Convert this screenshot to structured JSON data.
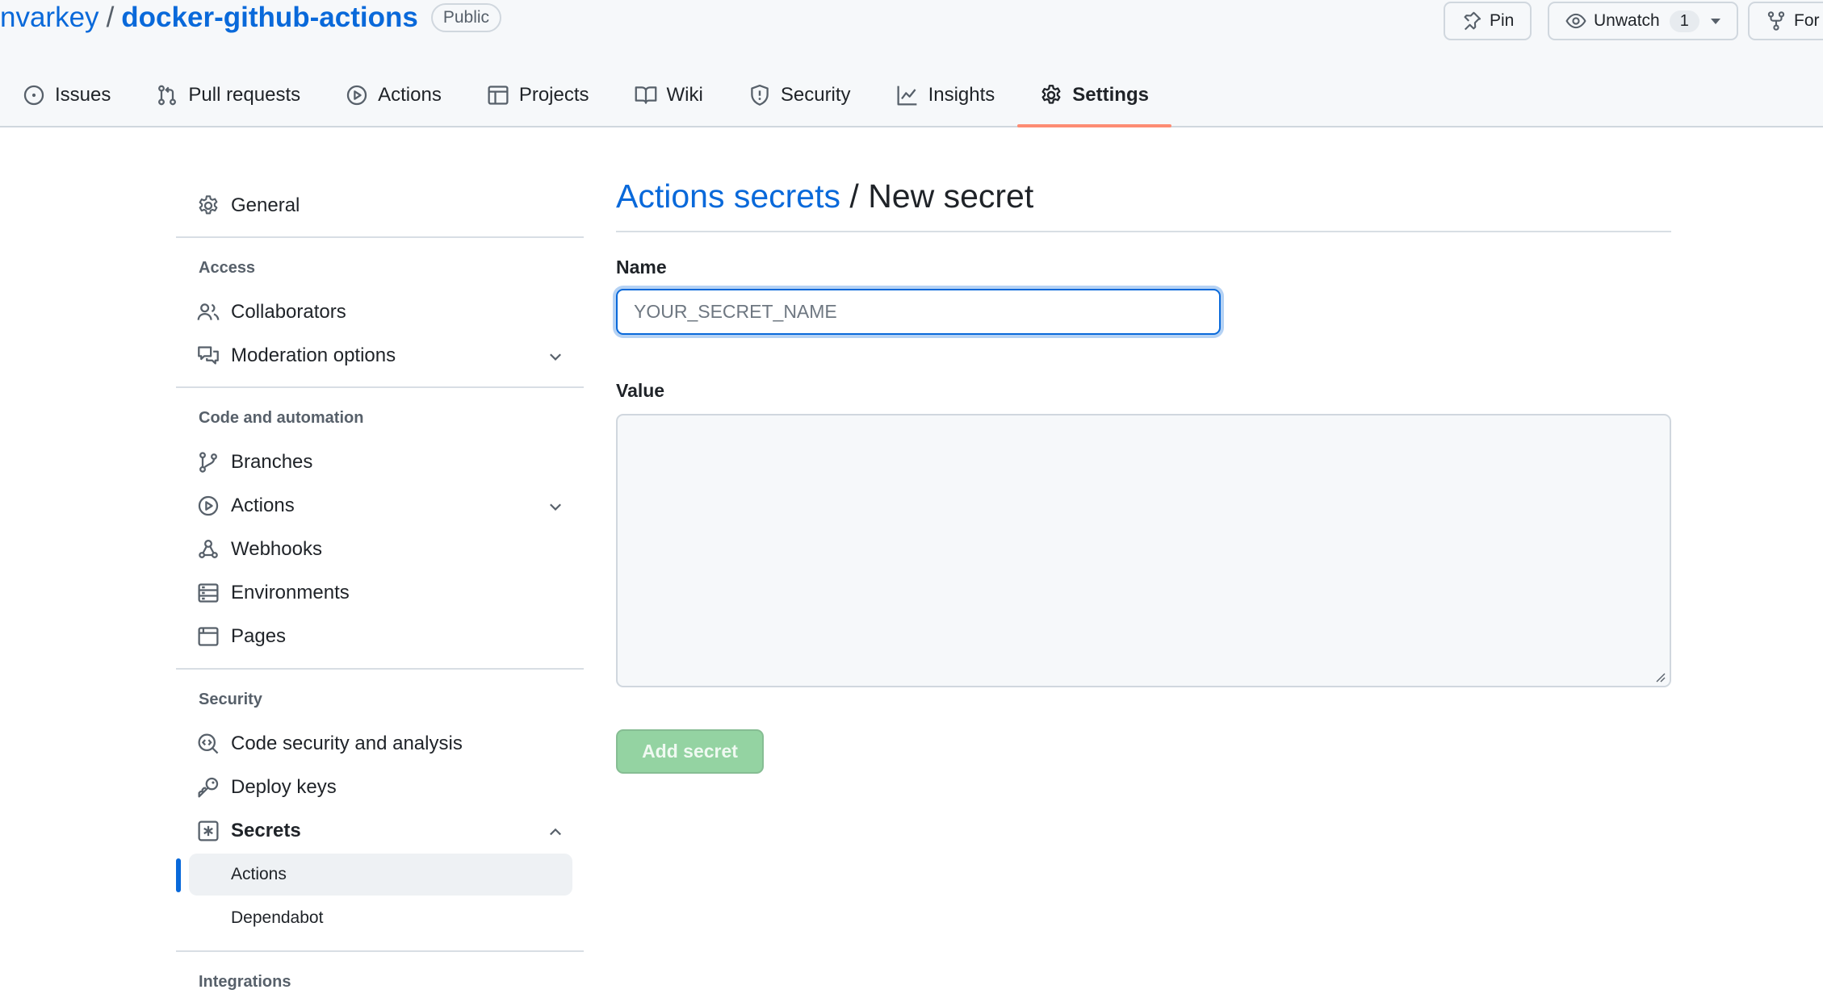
{
  "repo": {
    "owner": "nvarkey",
    "separator": "/",
    "name": "docker-github-actions",
    "visibility": "Public"
  },
  "header_buttons": {
    "pin_label": "Pin",
    "unwatch_label": "Unwatch",
    "unwatch_count": "1",
    "fork_label": "For"
  },
  "tabs": [
    {
      "label": "Issues",
      "icon": "issue-opened-icon"
    },
    {
      "label": "Pull requests",
      "icon": "git-pull-request-icon"
    },
    {
      "label": "Actions",
      "icon": "play-icon"
    },
    {
      "label": "Projects",
      "icon": "table-icon"
    },
    {
      "label": "Wiki",
      "icon": "book-icon"
    },
    {
      "label": "Security",
      "icon": "shield-icon"
    },
    {
      "label": "Insights",
      "icon": "graph-icon"
    },
    {
      "label": "Settings",
      "icon": "gear-icon",
      "selected": true
    }
  ],
  "sidebar": {
    "general": "General",
    "access_heading": "Access",
    "collaborators": "Collaborators",
    "moderation": "Moderation options",
    "code_heading": "Code and automation",
    "branches": "Branches",
    "actions": "Actions",
    "webhooks": "Webhooks",
    "environments": "Environments",
    "pages": "Pages",
    "security_heading": "Security",
    "code_security": "Code security and analysis",
    "deploy_keys": "Deploy keys",
    "secrets": "Secrets",
    "secrets_actions": "Actions",
    "secrets_dependabot": "Dependabot",
    "integrations_heading": "Integrations"
  },
  "main": {
    "breadcrumb_link": "Actions secrets",
    "breadcrumb_sep": " / ",
    "title": "New secret",
    "name_label": "Name",
    "name_placeholder": "YOUR_SECRET_NAME",
    "name_value": "",
    "value_label": "Value",
    "value_value": "",
    "submit_label": "Add secret"
  },
  "colors": {
    "link": "#0969da",
    "selected_tab_underline": "#fd8c73",
    "disabled_primary_button": "#94d3a2",
    "focus_border": "#0969da"
  }
}
